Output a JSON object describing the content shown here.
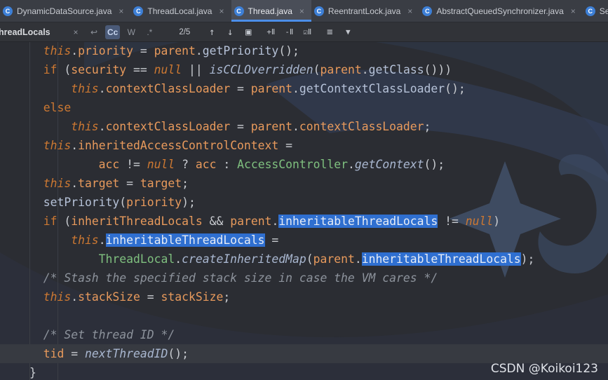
{
  "tabs": [
    {
      "label": "DynamicDataSource.java",
      "icon": "class-c-icon"
    },
    {
      "label": "ThreadLocal.java",
      "icon": "class-c-icon"
    },
    {
      "label": "Thread.java",
      "icon": "class-c-icon",
      "active": true
    },
    {
      "label": "ReentrantLock.java",
      "icon": "class-c-icon"
    },
    {
      "label": "AbstractQueuedSynchronizer.java",
      "icon": "class-c-icon"
    },
    {
      "label": "Semapho",
      "icon": "class-c-icon"
    }
  ],
  "tab_icon_glyph": "C",
  "close_glyph": "×",
  "search": {
    "value": "hreadLocals",
    "close": "×",
    "replace": "↩",
    "match_case": "Cc",
    "words": "W",
    "regex": ".*",
    "count": "2/5",
    "prev": "↑",
    "next": "↓",
    "select_all": "▣",
    "add_occurrence": "+Ⅱ",
    "remove_occurrence": "-Ⅱ",
    "select_all_occ": "☑Ⅱ",
    "filter_lines": "≡",
    "filter": "▼"
  },
  "code_lines": [
    [
      [
        "  this",
        "kw"
      ],
      [
        ".",
        "pl"
      ],
      [
        "priority",
        "fld"
      ],
      [
        " = ",
        "pl"
      ],
      [
        "parent",
        "fld"
      ],
      [
        ".",
        "pl"
      ],
      [
        "getPriority",
        "fn"
      ],
      [
        "();",
        "pl"
      ]
    ],
    [
      [
        "  if",
        "kwn"
      ],
      [
        " (",
        "pl"
      ],
      [
        "security",
        "fld"
      ],
      [
        " == ",
        "pl"
      ],
      [
        "null",
        "kw"
      ],
      [
        " || ",
        "pl"
      ],
      [
        "isCCLOverridden",
        "fni"
      ],
      [
        "(",
        "pl"
      ],
      [
        "parent",
        "fld"
      ],
      [
        ".",
        "pl"
      ],
      [
        "getClass",
        "fn"
      ],
      [
        "()))",
        "pl"
      ]
    ],
    [
      [
        "      this",
        "kw"
      ],
      [
        ".",
        "pl"
      ],
      [
        "contextClassLoader",
        "fld"
      ],
      [
        " = ",
        "pl"
      ],
      [
        "parent",
        "fld"
      ],
      [
        ".",
        "pl"
      ],
      [
        "getContextClassLoader",
        "fn"
      ],
      [
        "();",
        "pl"
      ]
    ],
    [
      [
        "  else",
        "kwn"
      ]
    ],
    [
      [
        "      this",
        "kw"
      ],
      [
        ".",
        "pl"
      ],
      [
        "contextClassLoader",
        "fld"
      ],
      [
        " = ",
        "pl"
      ],
      [
        "parent",
        "fld"
      ],
      [
        ".",
        "pl"
      ],
      [
        "contextClassLoader",
        "fld"
      ],
      [
        ";",
        "pl"
      ]
    ],
    [
      [
        "  this",
        "kw"
      ],
      [
        ".",
        "pl"
      ],
      [
        "inheritedAccessControlContext",
        "fld"
      ],
      [
        " =",
        "pl"
      ]
    ],
    [
      [
        "          acc",
        "fld"
      ],
      [
        " != ",
        "pl"
      ],
      [
        "null",
        "kw"
      ],
      [
        " ? ",
        "pl"
      ],
      [
        "acc",
        "fld"
      ],
      [
        " : ",
        "pl"
      ],
      [
        "AccessController",
        "cls"
      ],
      [
        ".",
        "pl"
      ],
      [
        "getContext",
        "fni"
      ],
      [
        "();",
        "pl"
      ]
    ],
    [
      [
        "  this",
        "kw"
      ],
      [
        ".",
        "pl"
      ],
      [
        "target",
        "fld"
      ],
      [
        " = ",
        "pl"
      ],
      [
        "target",
        "fld"
      ],
      [
        ";",
        "pl"
      ]
    ],
    [
      [
        "  setPriority",
        "fn"
      ],
      [
        "(",
        "pl"
      ],
      [
        "priority",
        "fld"
      ],
      [
        ");",
        "pl"
      ]
    ],
    [
      [
        "  if",
        "kwn"
      ],
      [
        " (",
        "pl"
      ],
      [
        "inheritThreadLocals",
        "fld"
      ],
      [
        " && ",
        "pl"
      ],
      [
        "parent",
        "fld"
      ],
      [
        ".",
        "pl"
      ],
      [
        "inheritableThreadLocals",
        "hl"
      ],
      [
        " != ",
        "pl"
      ],
      [
        "null",
        "kw"
      ],
      [
        ")",
        "pl"
      ]
    ],
    [
      [
        "      this",
        "kw"
      ],
      [
        ".",
        "pl"
      ],
      [
        "inheritableThreadLocals",
        "hl"
      ],
      [
        " =",
        "pl"
      ]
    ],
    [
      [
        "          ThreadLocal",
        "cls"
      ],
      [
        ".",
        "pl"
      ],
      [
        "createInheritedMap",
        "fni"
      ],
      [
        "(",
        "pl"
      ],
      [
        "parent",
        "fld"
      ],
      [
        ".",
        "pl"
      ],
      [
        "inheritableThreadLocals",
        "hl"
      ],
      [
        ");",
        "pl"
      ]
    ],
    [
      [
        "  /* Stash the specified stack size in case the VM cares */",
        "cm"
      ]
    ],
    [
      [
        "  this",
        "kw"
      ],
      [
        ".",
        "pl"
      ],
      [
        "stackSize",
        "fld"
      ],
      [
        " = ",
        "pl"
      ],
      [
        "stackSize",
        "fld"
      ],
      [
        ";",
        "pl"
      ]
    ],
    [
      [
        "",
        "pl"
      ]
    ],
    [
      [
        "  /* Set thread ID */",
        "cm"
      ]
    ],
    [
      [
        "  tid",
        "fld"
      ],
      [
        " = ",
        "pl"
      ],
      [
        "nextThreadID",
        "fni"
      ],
      [
        "();",
        "pl"
      ],
      [
        "|caret|",
        "caret"
      ]
    ],
    [
      [
        "}",
        "pl"
      ]
    ]
  ],
  "current_line_index": 16,
  "watermark_text": "CSDN @Koikoi123"
}
